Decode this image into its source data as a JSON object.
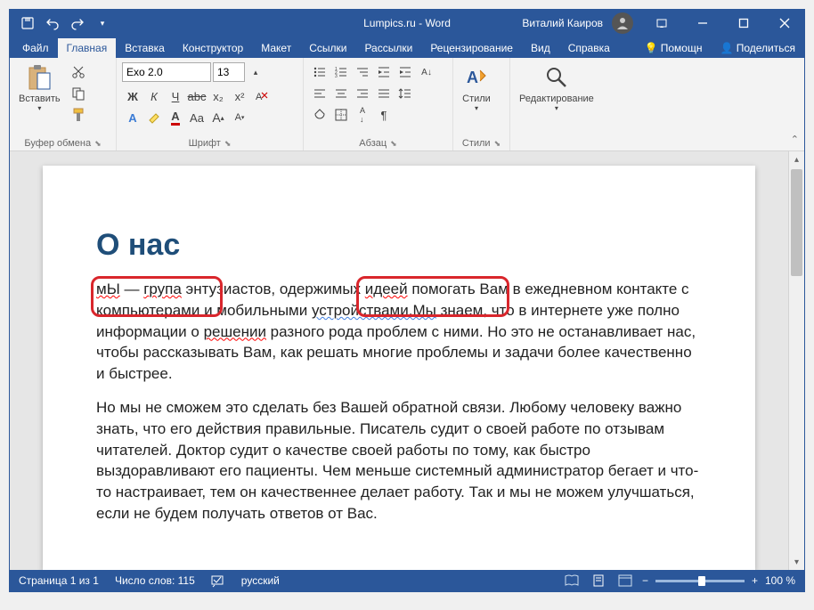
{
  "titlebar": {
    "title": "Lumpics.ru - Word",
    "user": "Виталий Каиров"
  },
  "tabs": {
    "items": [
      {
        "label": "Файл",
        "active": false
      },
      {
        "label": "Главная",
        "active": true
      },
      {
        "label": "Вставка",
        "active": false
      },
      {
        "label": "Конструктор",
        "active": false
      },
      {
        "label": "Макет",
        "active": false
      },
      {
        "label": "Ссылки",
        "active": false
      },
      {
        "label": "Рассылки",
        "active": false
      },
      {
        "label": "Рецензирование",
        "active": false
      },
      {
        "label": "Вид",
        "active": false
      },
      {
        "label": "Справка",
        "active": false
      }
    ],
    "aux": [
      {
        "label": "Помощн",
        "icon": "bulb"
      },
      {
        "label": "Поделиться",
        "icon": "share"
      }
    ]
  },
  "ribbon": {
    "clipboard": {
      "paste": "Вставить",
      "label": "Буфер обмена"
    },
    "font": {
      "name": "Exo 2.0",
      "size": "13",
      "label": "Шрифт"
    },
    "paragraph": {
      "label": "Абзац"
    },
    "styles": {
      "btn": "Стили",
      "label": "Стили"
    },
    "editing": {
      "btn": "Редактирование"
    }
  },
  "document": {
    "heading": "О нас",
    "p1_seg": {
      "a": "мЫ",
      "b": " — ",
      "c": "група",
      "d": " энтузиастов, одержимых ",
      "e": "идеей",
      "f": " помогать Вам в ежедневном контакте с компьютерами и мобильными ",
      "g": "устройствами.Мы",
      "h": " знаем, что в интернете уже полно информации о ",
      "i": "решении",
      "j": " разного рода проблем с ними. Но это не останавливает нас, чтобы рассказывать Вам, как решать многие проблемы и задачи более качественно и быстрее."
    },
    "p2": "Но мы не сможем это сделать без Вашей обратной связи. Любому человеку важно знать, что его действия правильные. Писатель судит о своей работе по отзывам читателей. Доктор судит о качестве своей работы по тому, как быстро выздоравливают его пациенты. Чем меньше системный администратор бегает и что-то настраивает, тем он качественнее делает работу. Так и мы не можем улучшаться, если не будем получать ответов от Вас."
  },
  "status": {
    "page": "Страница 1 из 1",
    "words": "Число слов: 115",
    "lang": "русский",
    "zoom": "100 %",
    "zoom_minus": "−",
    "zoom_plus": "+"
  }
}
